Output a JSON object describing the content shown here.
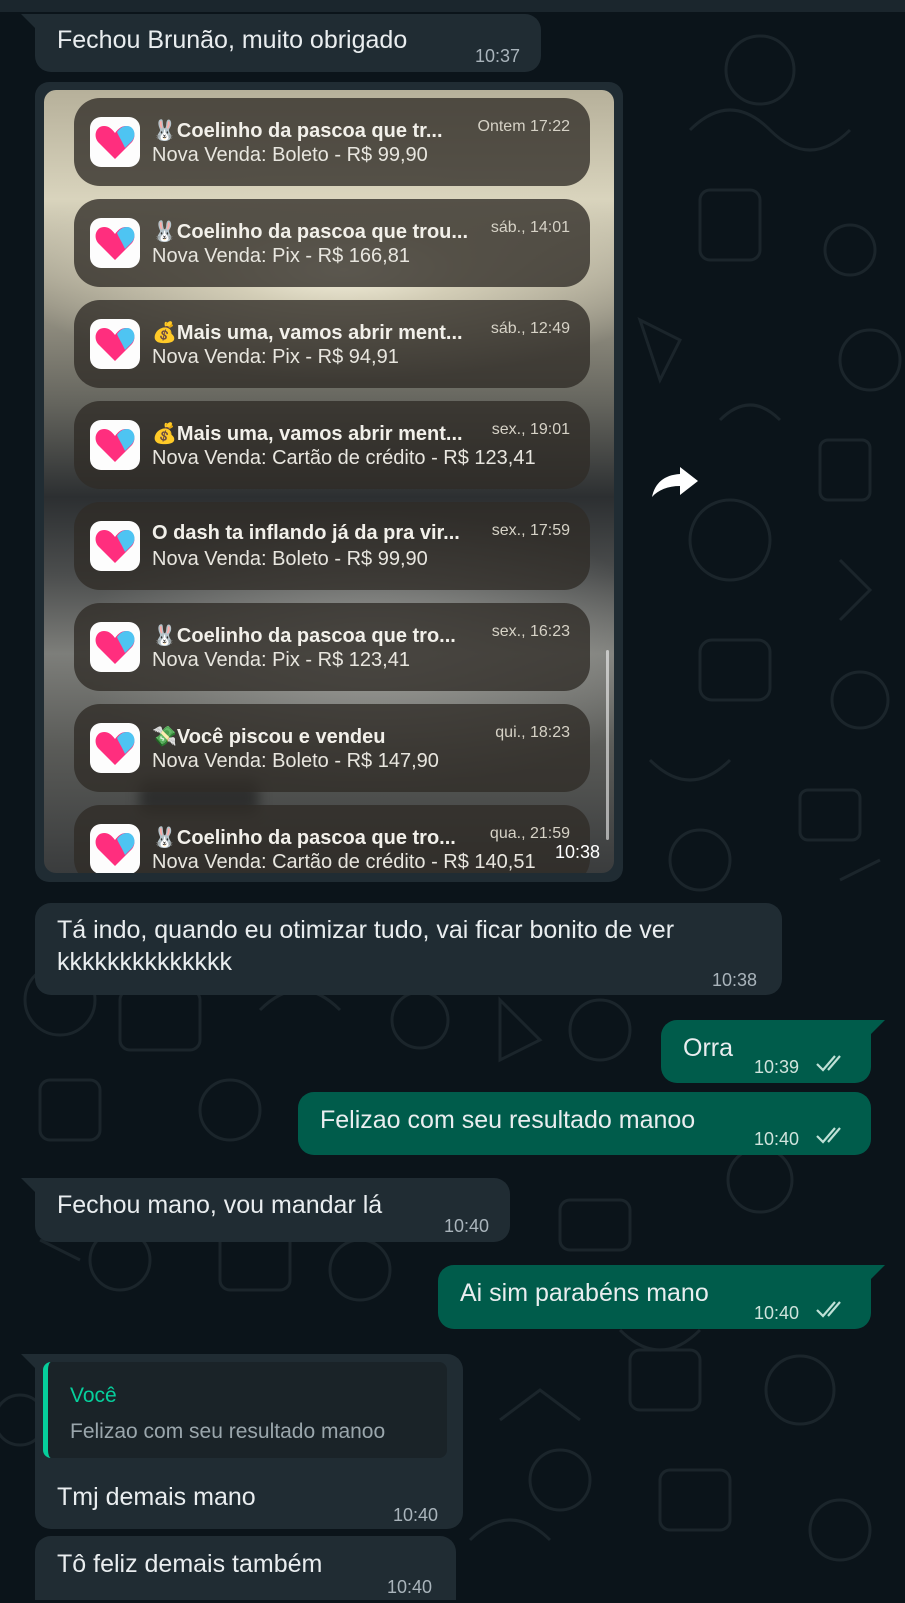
{
  "colors": {
    "background": "#0b141a",
    "incoming_bubble": "#202c33",
    "outgoing_bubble": "#005c4b",
    "read_ticks": "#bfe0d6",
    "quote_accent": "#06cf9c"
  },
  "messages": [
    {
      "dir": "in",
      "text": "Fechou Brunão, muito obrigado",
      "time": "10:37"
    },
    {
      "dir": "in",
      "type": "image",
      "time": "10:38"
    },
    {
      "dir": "in",
      "line1": "Tá indo, quando eu otimizar tudo, vai ficar bonito de ver",
      "line2": "kkkkkkkkkkkkkk",
      "time": "10:38"
    },
    {
      "dir": "out",
      "text": "Orra",
      "time": "10:39",
      "status": "read"
    },
    {
      "dir": "out",
      "text": "Felizao com seu resultado manoo",
      "time": "10:40",
      "status": "read"
    },
    {
      "dir": "in",
      "text": "Fechou mano, vou mandar lá",
      "time": "10:40"
    },
    {
      "dir": "out",
      "text": "Ai sim parabéns mano",
      "time": "10:40",
      "status": "read"
    },
    {
      "dir": "in",
      "quote": {
        "author": "Você",
        "text": "Felizao com seu resultado manoo"
      },
      "text": "Tmj demais mano",
      "time": "10:40"
    },
    {
      "dir": "in",
      "text": "Tô feliz demais também",
      "time": "10:40"
    }
  ],
  "screenshot_notifications": [
    {
      "icon": "🐰",
      "title": "Coelinho da pascoa que tr...",
      "body": "Nova Venda: Boleto - R$ 99,90",
      "time": "Ontem 17:22"
    },
    {
      "icon": "🐰",
      "title": "Coelinho da pascoa que trou...",
      "body": "Nova Venda: Pix - R$ 166,81",
      "time": "sáb., 14:01"
    },
    {
      "icon": "💰",
      "title": "Mais uma, vamos abrir ment...",
      "body": "Nova Venda: Pix - R$ 94,91",
      "time": "sáb., 12:49"
    },
    {
      "icon": "💰",
      "title": "Mais uma, vamos abrir ment...",
      "body": "Nova Venda: Cartão de crédito - R$ 123,41",
      "time": "sex., 19:01"
    },
    {
      "icon": "",
      "title": "O dash ta inflando já da pra vir...",
      "body": "Nova Venda: Boleto - R$ 99,90",
      "time": "sex., 17:59"
    },
    {
      "icon": "🐰",
      "title": "Coelinho da pascoa que tro...",
      "body": "Nova Venda: Pix - R$ 123,41",
      "time": "sex., 16:23"
    },
    {
      "icon": "💸",
      "title": "Você piscou e vendeu",
      "body": "Nova Venda: Boleto - R$ 147,90",
      "time": "qui., 18:23"
    },
    {
      "icon": "🐰",
      "title": "Coelinho da pascoa que tro...",
      "body": "Nova Venda: Cartão de crédito - R$ 140,51",
      "time": "qua., 21:59"
    }
  ]
}
